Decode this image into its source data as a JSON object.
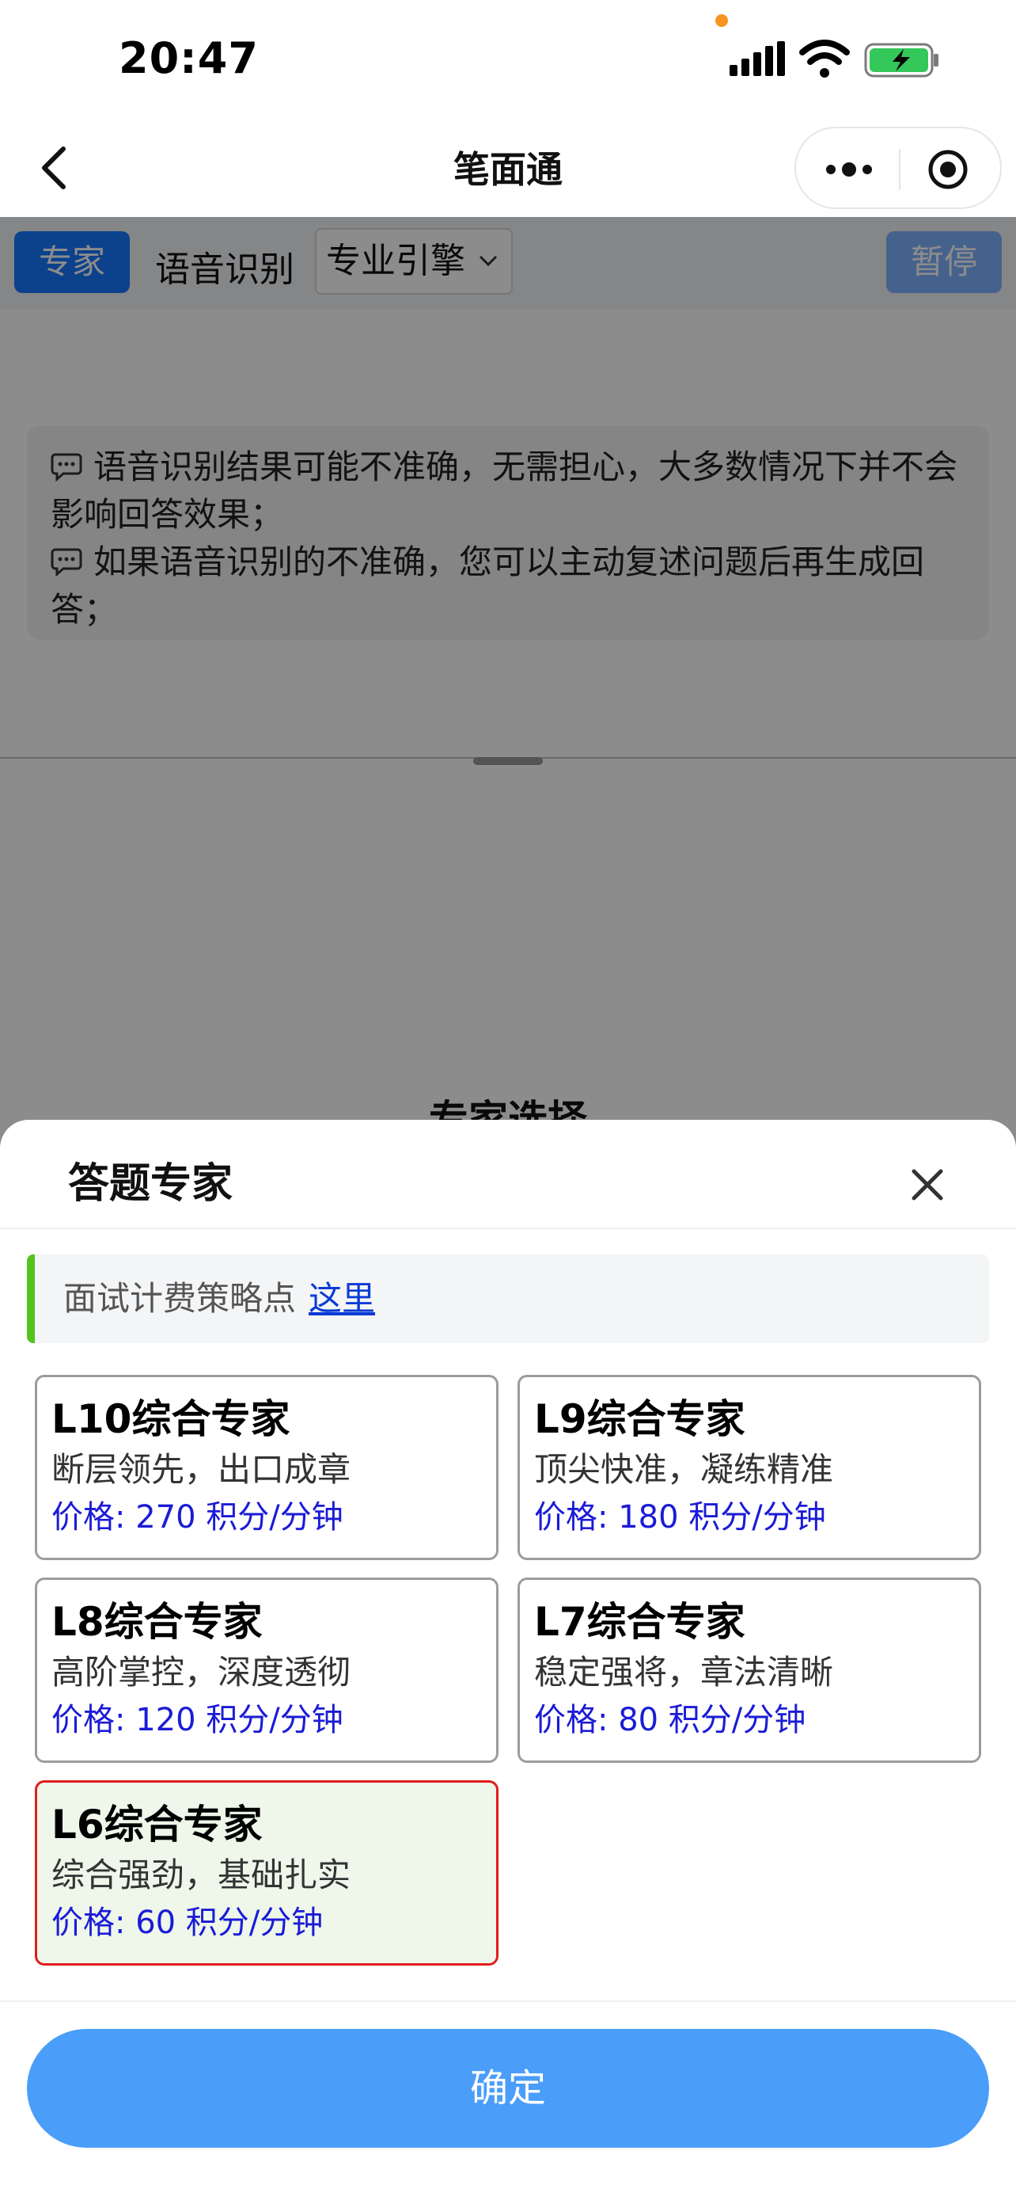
{
  "status_bar": {
    "time": "20:47"
  },
  "nav": {
    "title": "笔面通"
  },
  "toolbar": {
    "expert_label": "专家",
    "asr_label": "语音识别",
    "engine_value": "专业引擎",
    "pause_label": "暂停"
  },
  "notice": {
    "lines": [
      "语音识别结果可能不准确，无需担心，大多数情况下并不会影响回答效果；",
      "如果语音识别的不准确，您可以主动复述问题后再生成回答；"
    ]
  },
  "background": {
    "peek_title": "专家选择"
  },
  "sheet": {
    "title": "答题专家",
    "info_text": "面试计费策略点",
    "info_link": "这里",
    "experts": [
      {
        "title": "L10综合专家",
        "desc": "断层领先，出口成章",
        "price": "价格: 270 积分/分钟",
        "selected": false
      },
      {
        "title": "L9综合专家",
        "desc": "顶尖快准，凝练精准",
        "price": "价格: 180 积分/分钟",
        "selected": false
      },
      {
        "title": "L8综合专家",
        "desc": "高阶掌控，深度透彻",
        "price": "价格: 120 积分/分钟",
        "selected": false
      },
      {
        "title": "L7综合专家",
        "desc": "稳定强将，章法清晰",
        "price": "价格: 80 积分/分钟",
        "selected": false
      },
      {
        "title": "L6综合专家",
        "desc": "综合强劲，基础扎实",
        "price": "价格: 60 积分/分钟",
        "selected": true
      }
    ],
    "confirm_label": "确定"
  },
  "colors": {
    "accent": "#1677ff",
    "confirm": "#4a9df9",
    "selected_border": "#e11d1d",
    "selected_bg": "#eef7ea",
    "price_text": "#1b1bd6",
    "info_bar_accent": "#52c41a"
  },
  "icons": [
    "back-chevron-icon",
    "more-dots-icon",
    "target-icon",
    "chat-bubble-icon",
    "chevron-down-icon",
    "close-icon",
    "signal-icon",
    "wifi-icon",
    "battery-charging-icon"
  ]
}
